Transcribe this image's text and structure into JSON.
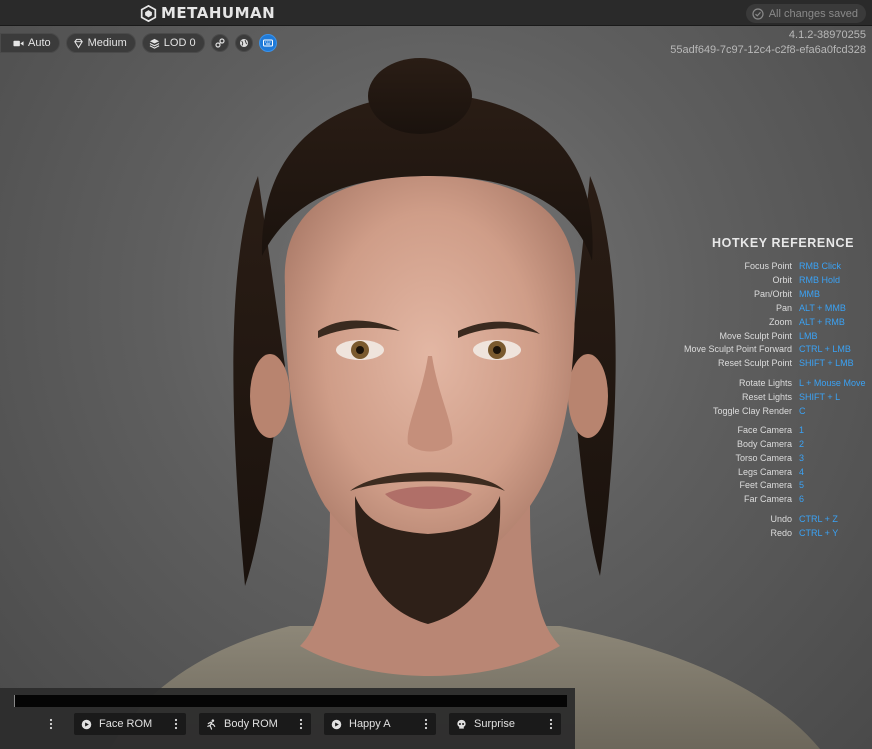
{
  "app": {
    "logo_text": "METAHUMAN",
    "save_status": "All changes saved",
    "save_icon": "check-circle-icon"
  },
  "toolbar": {
    "camera_mode": "Auto",
    "quality": "Medium",
    "lod": "LOD 0",
    "extra_icons": [
      "link-icon",
      "globe-icon",
      "keyboard-icon"
    ]
  },
  "build": {
    "version": "4.1.2-38970255",
    "guid": "55adf649-7c97-12c4-c2f8-efa6a0fcd328"
  },
  "hotkeys": {
    "title": "HOTKEY REFERENCE",
    "items": [
      {
        "label": "Focus Point",
        "key": "RMB Click"
      },
      {
        "label": "Orbit",
        "key": "RMB Hold"
      },
      {
        "label": "Pan/Orbit",
        "key": "MMB"
      },
      {
        "label": "Pan",
        "key": "ALT + MMB"
      },
      {
        "label": "Zoom",
        "key": "ALT + RMB"
      },
      {
        "label": "Move Sculpt Point",
        "key": "LMB"
      },
      {
        "label": "Move Sculpt Point Forward",
        "key": "CTRL + LMB"
      },
      {
        "label": "Reset Sculpt Point",
        "key": "SHIFT + LMB"
      },
      {
        "label": "Rotate Lights",
        "key": "L + Mouse Move"
      },
      {
        "label": "Reset Lights",
        "key": "SHIFT + L"
      },
      {
        "label": "Toggle Clay Render",
        "key": "C"
      },
      {
        "label": "Face Camera",
        "key": "1"
      },
      {
        "label": "Body Camera",
        "key": "2"
      },
      {
        "label": "Torso Camera",
        "key": "3"
      },
      {
        "label": "Legs Camera",
        "key": "4"
      },
      {
        "label": "Feet Camera",
        "key": "5"
      },
      {
        "label": "Far Camera",
        "key": "6"
      },
      {
        "label": "Undo",
        "key": "CTRL + Z"
      },
      {
        "label": "Redo",
        "key": "CTRL + Y"
      }
    ]
  },
  "animations": {
    "slots": [
      {
        "label": "Face ROM",
        "icon": "face-icon"
      },
      {
        "label": "Body ROM",
        "icon": "running-figure-icon"
      },
      {
        "label": "Happy A",
        "icon": "face-icon"
      },
      {
        "label": "Surprise",
        "icon": "skull-icon"
      }
    ]
  },
  "colors": {
    "accent": "#3aa2f5",
    "active_button": "#1f7ad8",
    "topbar": "#2a2a2a",
    "viewport_bg": "#636363"
  }
}
